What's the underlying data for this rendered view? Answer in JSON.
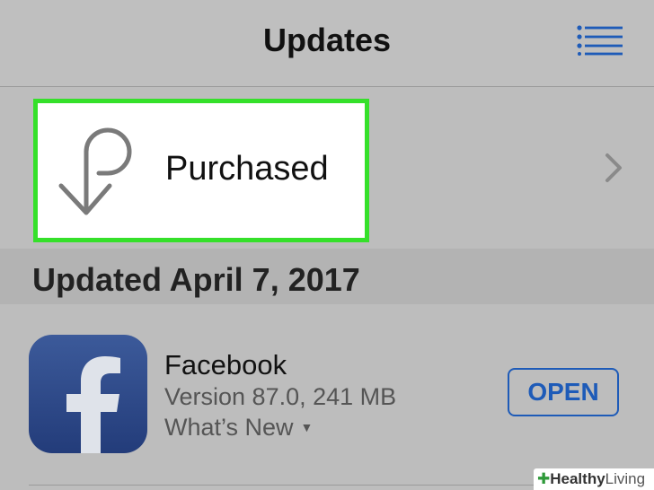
{
  "navbar": {
    "title": "Updates",
    "menu_icon": "list-icon"
  },
  "purchased": {
    "label": "Purchased",
    "icon": "purchase-arrow-icon",
    "highlight_color": "#35e02a",
    "chevron_icon": "chevron-right-icon"
  },
  "section": {
    "title": "Updated April 7, 2017"
  },
  "app": {
    "name": "Facebook",
    "version": "Version 87.0, 241 MB",
    "whats_new": "What’s New",
    "open_label": "OPEN",
    "icon": "facebook-app-icon",
    "brand_color": "#3b5998",
    "accent_color": "#1e5bb8"
  },
  "watermark": {
    "part1": "Healthy",
    "part2": "Living"
  }
}
